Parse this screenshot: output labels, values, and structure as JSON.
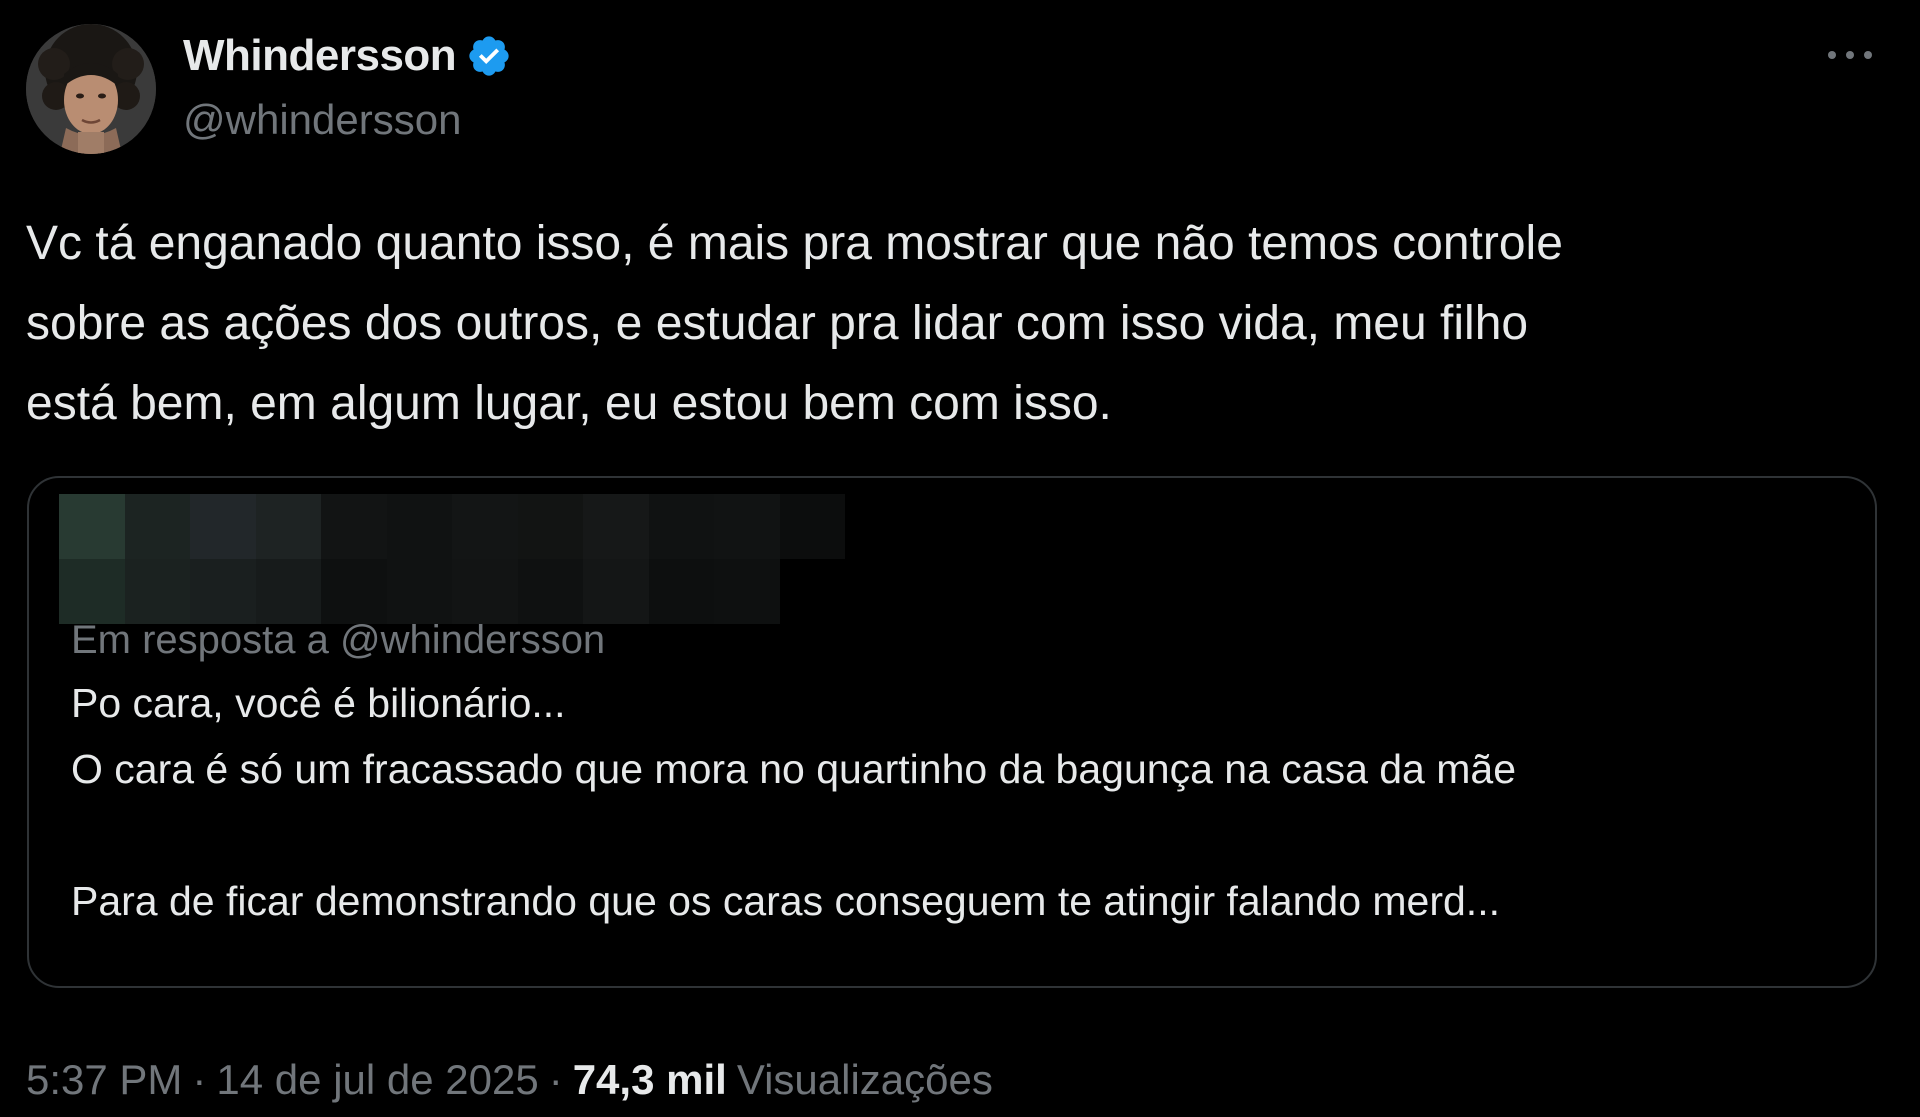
{
  "author": {
    "display_name": "Whindersson",
    "handle": "@whindersson",
    "verified": true,
    "avatar_icon": "profile-photo-icon"
  },
  "tweet": {
    "text": "Vc tá enganado quanto isso, é mais pra mostrar que não temos controle\nsobre as ações dos outros, e estudar pra lidar com isso vida, meu filho\nestá bem, em algum lugar, eu estou bem com isso."
  },
  "quoted_tweet": {
    "author_pixelated": true,
    "reply_context": "Em resposta a @whindersson",
    "text": "Po cara, você é bilionário...\nO cara é só um fracassado que mora no quartinho da bagunça na casa da mãe\n\nPara de ficar demonstrando que os caras conseguem te atingir falando merd..."
  },
  "meta": {
    "time": "5:37 PM",
    "date": "14 de jul de 2025",
    "separator": "·",
    "views_count": "74,3 mil",
    "views_label": "Visualizações"
  },
  "colors": {
    "background": "#000000",
    "primary_text": "#e7e9ea",
    "secondary_text": "#71767b",
    "border": "#2f3336",
    "verified_blue": "#1d9bf0"
  },
  "icons": {
    "more": "more-horizontal-icon",
    "verified": "verified-badge-icon"
  }
}
